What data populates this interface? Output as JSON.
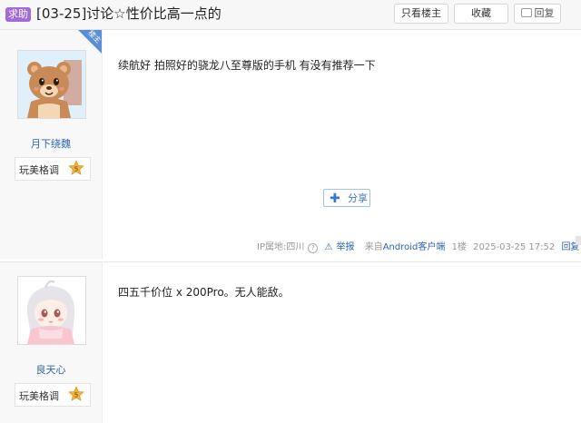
{
  "header": {
    "tag": "求助",
    "title": "[03-25]讨论☆性价比高一点的",
    "only_owner": "只看楼主",
    "favorite": "收藏",
    "reply": "回复"
  },
  "posts": [
    {
      "owner_badge": "楼主",
      "username": "月下绕魏",
      "level_name": "玩美格调",
      "level_num": "5",
      "content": "续航好 拍照好的骁龙八至尊版的手机 有没有推荐一下",
      "share": "分享",
      "ip": "IP属地:四川",
      "report": "举报",
      "source_prefix": "来自",
      "source_client": "Android客户端",
      "floor": "1楼",
      "time": "2025-03-25 17:52",
      "reply": "回复"
    },
    {
      "username": "良天心",
      "level_name": "玩美格调",
      "level_num": "5",
      "content": "四五千价位 x 200Pro。无人能敌。"
    }
  ],
  "colors": {
    "tag_bg": "#a06ad8",
    "link": "#2d64b3",
    "badge": "#5a8fd8",
    "star": "#f0b23a"
  }
}
